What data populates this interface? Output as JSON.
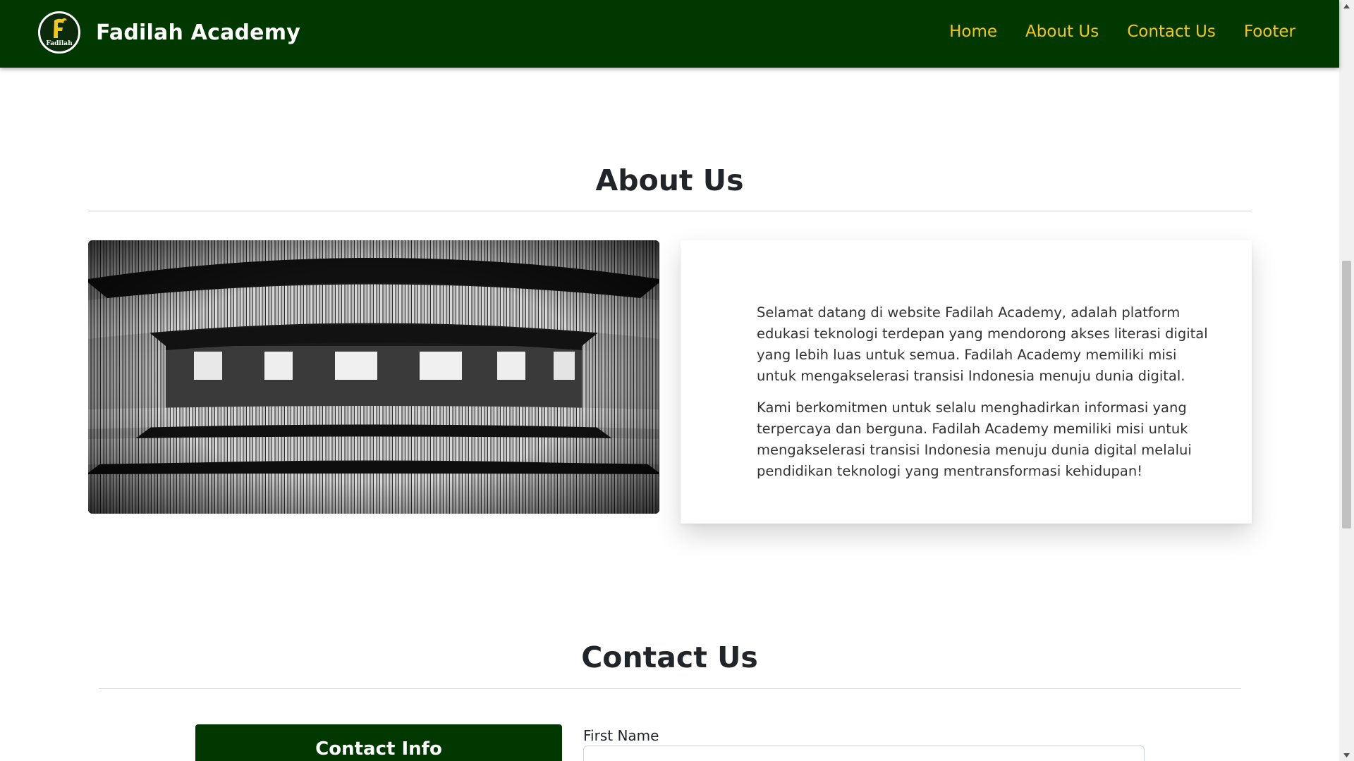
{
  "navbar": {
    "brand": "Fadilah Academy",
    "logo_letter": "F",
    "logo_text": "Fadilah",
    "links": [
      "Home",
      "About Us",
      "Contact Us",
      "Footer"
    ]
  },
  "about": {
    "title": "About Us",
    "image_icon": "library-bookshelves-photo",
    "paragraphs": [
      "Selamat datang di website Fadilah Academy, adalah platform edukasi teknologi terdepan yang mendorong akses literasi digital yang lebih luas untuk semua. Fadilah Academy memiliki misi untuk mengakselerasi transisi Indonesia menuju dunia digital.",
      "Kami berkomitmen untuk selalu menghadirkan informasi yang terpercaya dan berguna. Fadilah Academy memiliki misi untuk mengakselerasi transisi Indonesia menuju dunia digital melalui pendidikan teknologi yang mentransformasi kehidupan!"
    ]
  },
  "contact": {
    "title": "Contact Us",
    "info_title": "Contact Info",
    "first_name_label": "First Name",
    "first_name_value": ""
  },
  "colors": {
    "navbar_bg": "#003800",
    "nav_link": "#f5c518",
    "brand_text": "#ffffff"
  }
}
